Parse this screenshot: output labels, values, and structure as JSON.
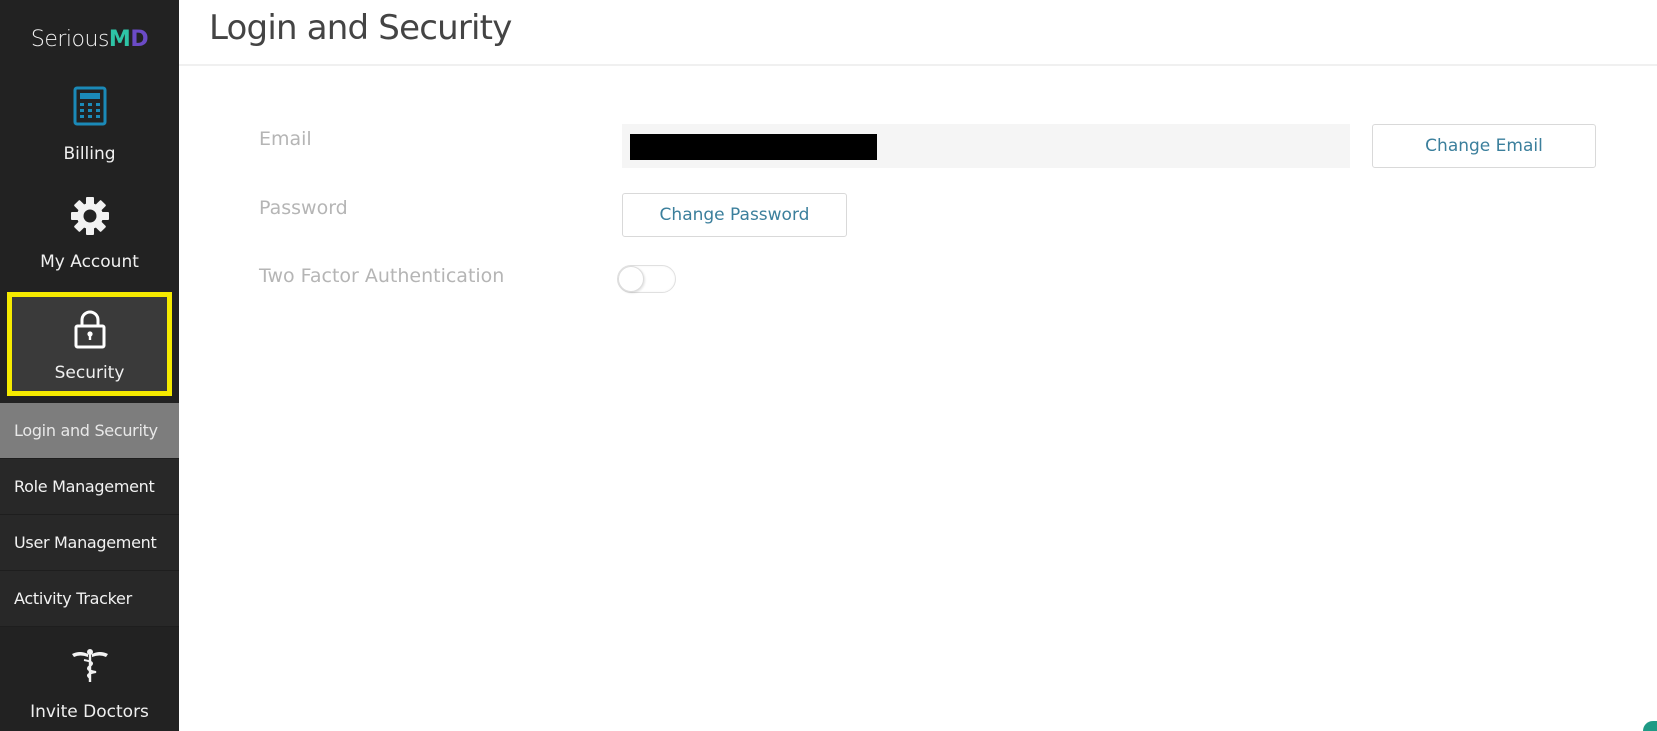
{
  "brand": {
    "name_main": "Serious",
    "name_m": "M",
    "name_d": "D",
    "colors": {
      "m": "#2ec4a6",
      "d": "#6b4bc6"
    }
  },
  "sidebar": {
    "tiles": [
      {
        "label": "Billing",
        "icon": "calculator-icon"
      },
      {
        "label": "My Account",
        "icon": "gear-icon"
      },
      {
        "label": "Security",
        "icon": "lock-icon",
        "selected": true,
        "highlight_color": "#f5ea00"
      },
      {
        "label": "Invite Doctors",
        "icon": "caduceus-icon"
      }
    ],
    "subnav": [
      {
        "label": "Login and Security",
        "active": true
      },
      {
        "label": "Role Management",
        "active": false
      },
      {
        "label": "User Management",
        "active": false
      },
      {
        "label": "Activity Tracker",
        "active": false
      }
    ]
  },
  "page": {
    "title": "Login and Security"
  },
  "form": {
    "email_label": "Email",
    "email_value": "[redacted]",
    "change_email_label": "Change Email",
    "password_label": "Password",
    "change_password_label": "Change Password",
    "two_factor_label": "Two Factor Authentication",
    "two_factor_enabled": false
  },
  "colors": {
    "sidebar_bg": "#222222",
    "accent_link": "#3b7f9c",
    "billing_icon": "#1b8ab8",
    "active_subnav": "#7d7d7d"
  }
}
